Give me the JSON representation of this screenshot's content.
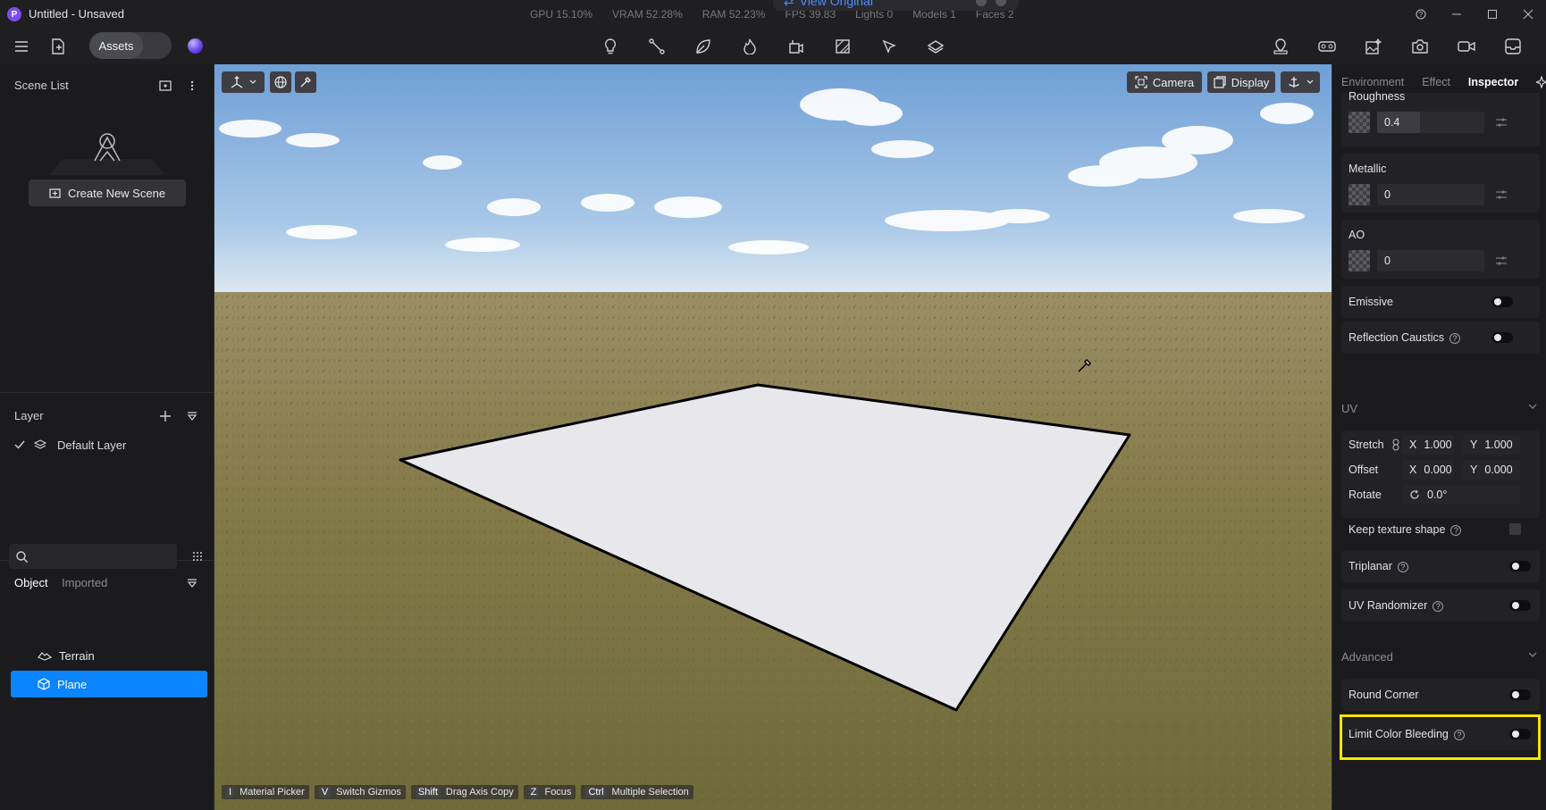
{
  "window": {
    "title": "Untitled - Unsaved",
    "logo": "P"
  },
  "stats": {
    "gpu": "GPU 15.10%",
    "vram": "VRAM 52.28%",
    "ram": "RAM 52.23%",
    "fps": "FPS 39.83",
    "lights": "Lights 0",
    "models": "Models 1",
    "faces": "Faces 2"
  },
  "view_original": {
    "label": "View Original"
  },
  "toolbar": {
    "assets": "Assets"
  },
  "left": {
    "scene_list": {
      "title": "Scene List",
      "create": "Create New Scene"
    },
    "layer": {
      "title": "Layer",
      "items": [
        {
          "label": "Default Layer"
        }
      ]
    },
    "objects": {
      "tab_object": "Object",
      "tab_imported": "Imported",
      "search_placeholder": "",
      "items": [
        {
          "label": "Terrain"
        },
        {
          "label": "Plane"
        }
      ]
    }
  },
  "viewport": {
    "camera": "Camera",
    "display": "Display",
    "shortcuts": [
      {
        "key": "I",
        "label": "Material Picker"
      },
      {
        "key": "V",
        "label": "Switch Gizmos"
      },
      {
        "key": "Shift",
        "label": "Drag Axis Copy"
      },
      {
        "key": "Z",
        "label": "Focus"
      },
      {
        "key": "Ctrl",
        "label": "Multiple Selection"
      }
    ]
  },
  "inspector": {
    "tabs": [
      "Environment",
      "Effect",
      "Inspector"
    ],
    "roughness": {
      "label": "Roughness",
      "value": "0.4",
      "fill_fraction": 0.4
    },
    "metallic": {
      "label": "Metallic",
      "value": "0"
    },
    "ao": {
      "label": "AO",
      "value": "0"
    },
    "emissive": {
      "label": "Emissive",
      "on": false
    },
    "reflection_caustics": {
      "label": "Reflection Caustics",
      "on": false
    },
    "uv": {
      "title": "UV",
      "stretch": {
        "label": "Stretch",
        "x_label": "X",
        "x": "1.000",
        "y_label": "Y",
        "y": "1.000"
      },
      "offset": {
        "label": "Offset",
        "x_label": "X",
        "x": "0.000",
        "y_label": "Y",
        "y": "0.000"
      },
      "rotate": {
        "label": "Rotate",
        "value": "0.0°"
      },
      "keep_texture": {
        "label": "Keep texture shape"
      },
      "triplanar": {
        "label": "Triplanar"
      },
      "uv_randomizer": {
        "label": "UV Randomizer"
      }
    },
    "advanced": {
      "title": "Advanced",
      "round_corner": {
        "label": "Round Corner"
      },
      "limit_color_bleeding": {
        "label": "Limit Color Bleeding"
      }
    }
  },
  "colors": {
    "accent": "#0a84ff",
    "highlight": "#f5e600",
    "sky_top": "#6f9fd6",
    "ground": "#8b7d4e"
  }
}
